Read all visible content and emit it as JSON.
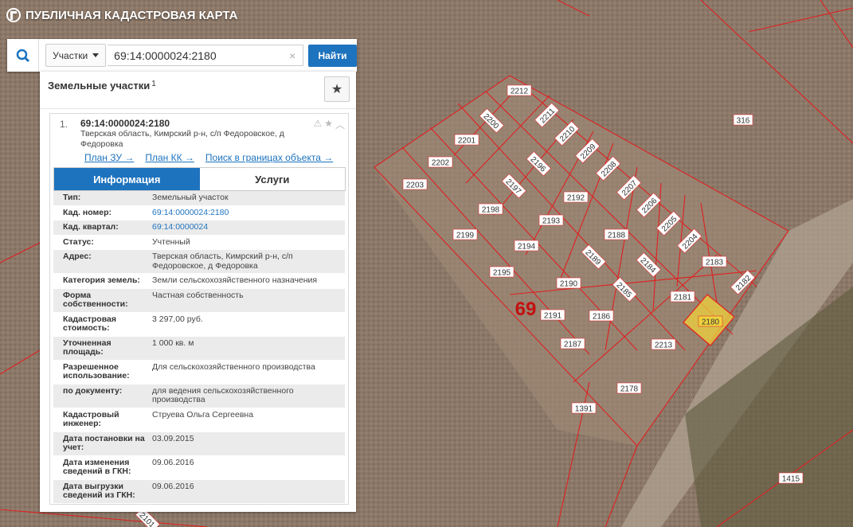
{
  "app": {
    "title": "ПУБЛИЧНАЯ КАДАСТРОВАЯ КАРТА"
  },
  "search": {
    "type_label": "Участки",
    "value": "69:14:0000024:2180",
    "clear_glyph": "×",
    "find_label": "Найти"
  },
  "panel": {
    "title": "Земельные участки",
    "count": "1",
    "favorite_icon": "star-icon"
  },
  "card": {
    "index": "1.",
    "cad_number": "69:14:0000024:2180",
    "address": "Тверская область, Кимрский р-н, с/п Федоровское, д Федоровка",
    "links": [
      "План ЗУ →",
      "План КК →",
      "Поиск в границах объекта →"
    ],
    "tabs": {
      "info": "Информация",
      "services": "Услуги"
    },
    "fields": [
      {
        "k": "Тип:",
        "v": "Земельный участок",
        "link": false
      },
      {
        "k": "Кад. номер:",
        "v": "69:14:0000024:2180",
        "link": true
      },
      {
        "k": "Кад. квартал:",
        "v": "69:14:0000024",
        "link": true
      },
      {
        "k": "Статус:",
        "v": "Учтенный",
        "link": false
      },
      {
        "k": "Адрес:",
        "v": "Тверская область, Кимрский р-н, с/п Федоровское, д Федоровка",
        "link": false
      },
      {
        "k": "Категория земель:",
        "v": "Земли сельскохозяйственного назначения",
        "link": false
      },
      {
        "k": "Форма собственности:",
        "v": "Частная собственность",
        "link": false
      },
      {
        "k": "Кадастровая стоимость:",
        "v": "3 297,00 руб.",
        "link": false
      },
      {
        "k": "Уточненная площадь:",
        "v": "1 000 кв. м",
        "link": false
      },
      {
        "k": "Разрешенное использование:",
        "v": "Для сельскохозяйственного производства",
        "link": false
      },
      {
        "k": "по документу:",
        "v": "для ведения сельскохозяйственного производства",
        "link": false
      },
      {
        "k": "Кадастровый инженер:",
        "v": "Струева Ольга Сергеевна",
        "link": false
      },
      {
        "k": "Дата постановки на учет:",
        "v": "03.09.2015",
        "link": false
      },
      {
        "k": "Дата изменения сведений в ГКН:",
        "v": "09.06.2016",
        "link": false
      },
      {
        "k": "Дата выгрузки сведений из ГКН:",
        "v": "09.06.2016",
        "link": false
      }
    ]
  },
  "map": {
    "region_label": "69",
    "highlight_color": "#f0d23c",
    "boundary_color": "#e02020",
    "plots": [
      "2212",
      "2200",
      "2211",
      "2210",
      "2201",
      "2209",
      "2196",
      "2208",
      "2202",
      "2203",
      "2197",
      "2192",
      "2207",
      "2206",
      "2198",
      "2193",
      "2205",
      "2199",
      "2188",
      "2194",
      "2204",
      "2189",
      "2183",
      "2184",
      "2195",
      "2190",
      "2182",
      "2185",
      "2181",
      "2191",
      "2186",
      "2180",
      "2213",
      "2187",
      "2178",
      "1391",
      "316",
      "1415",
      "2101"
    ]
  }
}
